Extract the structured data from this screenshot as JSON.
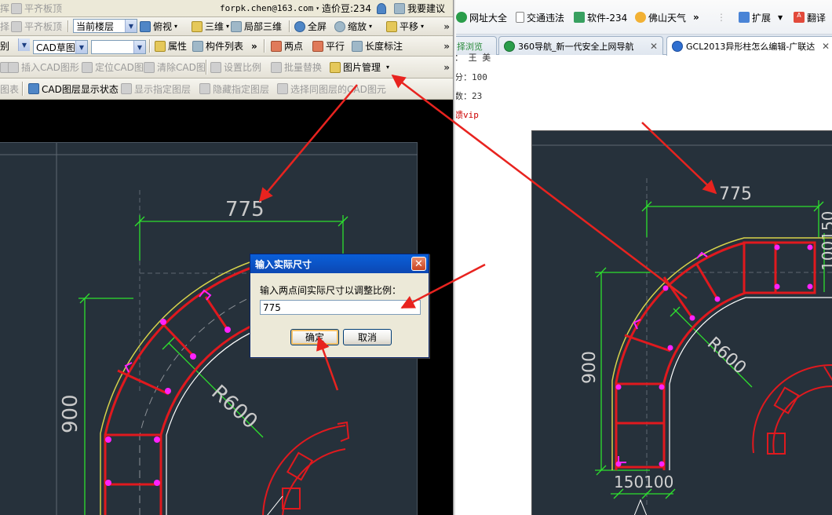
{
  "cad_app": {
    "top_bar": {
      "left_item": "平齐板顶",
      "left_item_prefix": "挥",
      "account": "forpk.chen@163.com",
      "price_label": "造价豆:234",
      "suggest_label": "我要建议"
    },
    "toolbar1": {
      "floor_select": "当前楼层",
      "view": "俯视",
      "three_d": "三维",
      "partial_3d": "局部三维",
      "fullscreen": "全屏",
      "zoom": "缩放",
      "pan": "平移"
    },
    "toolbar2": {
      "prefix": "别",
      "cad_select": "CAD草图",
      "empty_select": "",
      "properties": "属性",
      "component_list": "构件列表",
      "two_point": "两点",
      "parallel": "平行",
      "dimension": "长度标注"
    },
    "toolbar3": {
      "insert_cad": "插入CAD图形",
      "locate_cad": "定位CAD图",
      "clear_cad": "清除CAD图",
      "set_scale": "设置比例",
      "batch_replace": "批量替换",
      "image_manage": "图片管理"
    },
    "toolbar4": {
      "prefix": "图表",
      "layer_status": "CAD图层显示状态",
      "show_layer": "显示指定图层",
      "hide_layer": "隐藏指定图层",
      "select_same_layer": "选择同图层的CAD图元"
    },
    "dialog": {
      "title": "输入实际尺寸",
      "label": "输入两点间实际尺寸以调整比例：",
      "input_value": "775",
      "ok": "确定",
      "cancel": "取消",
      "close": "✕"
    },
    "drawing": {
      "dim_top": "775",
      "dim_left": "900",
      "radius": "R600"
    }
  },
  "browser": {
    "favorites": {
      "site_nav": "网址大全",
      "traffic": "交通违法",
      "software": "软件-234",
      "weather": "佛山天气",
      "more": "»",
      "extensions": "扩展",
      "translate": "翻译"
    },
    "tabs": [
      {
        "label": "择浏览"
      },
      {
        "label": "360导航_新一代安全上网导航"
      },
      {
        "label": "GCL2013异形柱怎么编辑-广联达"
      }
    ],
    "page_text": {
      "line1": "：  王    美",
      "line2": "分：100",
      "line3": "数：23",
      "line4": "馈vip"
    },
    "drawing": {
      "dim_top": "775",
      "dim_left": "900",
      "radius": "R600",
      "dim_bottom": "150100",
      "dim_right": "100150"
    }
  },
  "colors": {
    "cad_background": "#26313b",
    "rebar": "#e0191e",
    "dimension": "#2ee02e",
    "stirrup_dot": "#ff22ff",
    "arrow": "#e8231f"
  }
}
